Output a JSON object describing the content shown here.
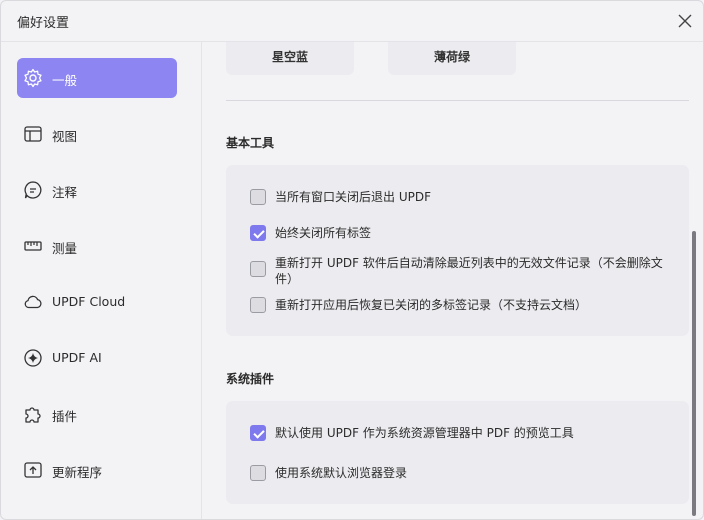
{
  "window": {
    "title": "偏好设置"
  },
  "sidebar": {
    "items": [
      {
        "label": "一般",
        "icon": "gear-icon"
      },
      {
        "label": "视图",
        "icon": "layout-icon"
      },
      {
        "label": "注释",
        "icon": "comment-icon"
      },
      {
        "label": "测量",
        "icon": "ruler-icon"
      },
      {
        "label": "UPDF Cloud",
        "icon": "cloud-icon"
      },
      {
        "label": "UPDF AI",
        "icon": "ai-sparkle-icon"
      },
      {
        "label": "插件",
        "icon": "puzzle-icon"
      },
      {
        "label": "更新程序",
        "icon": "update-icon"
      }
    ],
    "active_index": 0
  },
  "theme": {
    "options": [
      "星空蓝",
      "薄荷绿"
    ]
  },
  "sections": {
    "basic": {
      "title": "基本工具",
      "options": [
        {
          "label": "当所有窗口关闭后退出 UPDF",
          "checked": false
        },
        {
          "label": "始终关闭所有标签",
          "checked": true
        },
        {
          "label": "重新打开 UPDF 软件后自动清除最近列表中的无效文件记录（不会删除文件）",
          "checked": false
        },
        {
          "label": "重新打开应用后恢复已关闭的多标签记录（不支持云文档）",
          "checked": false
        }
      ]
    },
    "plugins": {
      "title": "系统插件",
      "options": [
        {
          "label": "默认使用 UPDF 作为系统资源管理器中 PDF 的预览工具",
          "checked": true
        },
        {
          "label": "使用系统默认浏览器登录",
          "checked": false
        }
      ]
    }
  },
  "colors": {
    "accent": "#8c85f2",
    "checkbox_checked": "#7f79ee"
  }
}
